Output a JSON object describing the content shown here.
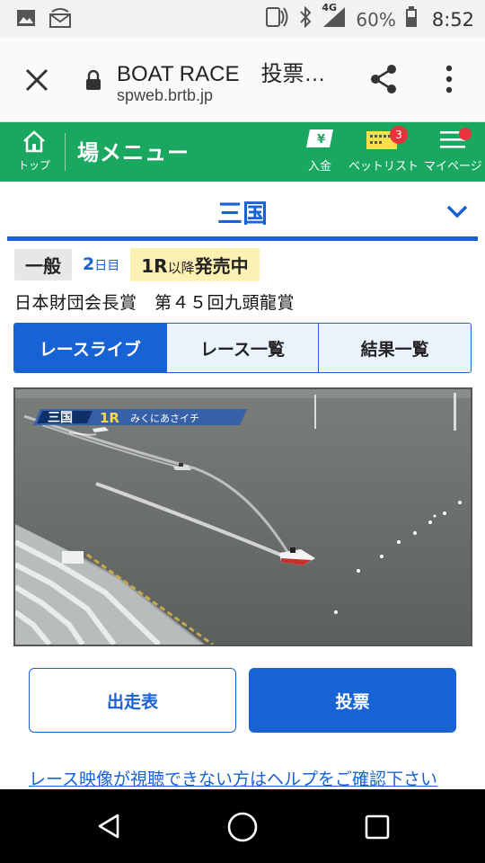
{
  "status": {
    "network": "4G",
    "battery_pct": "60%",
    "time": "8:52"
  },
  "browser": {
    "title": "BOAT RACE　投票…",
    "url": "spweb.brtb.jp"
  },
  "header": {
    "home_label": "トップ",
    "title": "場メニュー",
    "deposit_label": "入金",
    "betlist_label": "ベットリスト",
    "betlist_badge": "3",
    "mypage_label": "マイページ",
    "accent": "#1aa760"
  },
  "venue": {
    "name": "三国"
  },
  "race_info": {
    "grade": "一般",
    "day_num": "2",
    "day_unit": "日目",
    "sale_prefix": "1R",
    "sale_small": "以降",
    "sale_text": "発売中",
    "race_name": "日本財団会長賞　第４５回九頭龍賞"
  },
  "tabs": [
    {
      "label": "レースライブ",
      "active": true
    },
    {
      "label": "レース一覧",
      "active": false
    },
    {
      "label": "結果一覧",
      "active": false
    }
  ],
  "video": {
    "overlay_venue": "三国",
    "overlay_race": "1R",
    "overlay_text": "みくにあさイチ"
  },
  "actions": {
    "entry_label": "出走表",
    "vote_label": "投票"
  },
  "help_link": "レース映像が視聴できない方はヘルプをご確認下さい",
  "colors": {
    "primary": "#1763d5",
    "green": "#1aa760",
    "badge": "#e8333d"
  }
}
